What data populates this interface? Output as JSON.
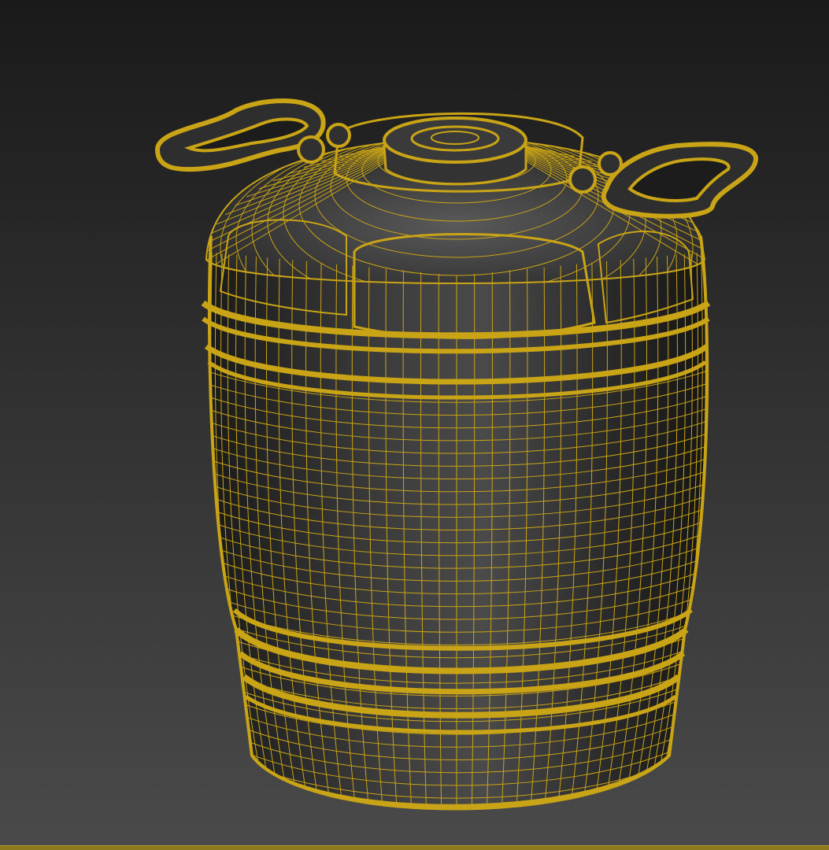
{
  "viewport": {
    "mode": "perspective-shaded-wireframe",
    "object_name": "plastic-barrel",
    "wire_color": "#c9a416",
    "shade_dark": "#1e1e1e",
    "shade_mid": "#3a3a3a",
    "shade_light": "#5a5a5a",
    "background_top": "#1a1a1a",
    "background_bottom": "#4a4a4a",
    "frame_color": "#8d7a1c"
  }
}
